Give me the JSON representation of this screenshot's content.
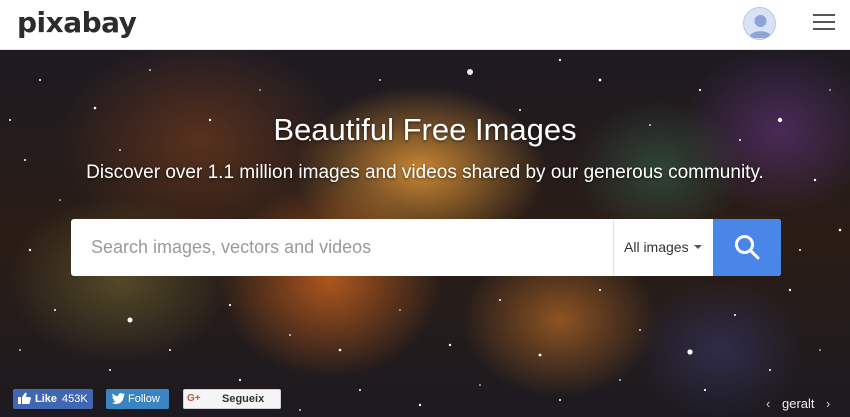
{
  "header": {
    "logo": "pixabay"
  },
  "hero": {
    "title": "Beautiful Free Images",
    "subtitle": "Discover over 1.1 million images and videos shared by our generous community.",
    "search": {
      "placeholder": "Search images, vectors and videos",
      "value": "",
      "type_selected": "All images",
      "button_color": "#4a86e8"
    }
  },
  "social": {
    "facebook": {
      "label": "Like",
      "count": "453K",
      "color": "#4267b2"
    },
    "twitter": {
      "label": "Follow",
      "color": "#3a84c2"
    },
    "google": {
      "icon_text": "G+",
      "label": "Segueix"
    }
  },
  "credit": {
    "prev": "‹",
    "author": "geralt",
    "next": "›"
  }
}
